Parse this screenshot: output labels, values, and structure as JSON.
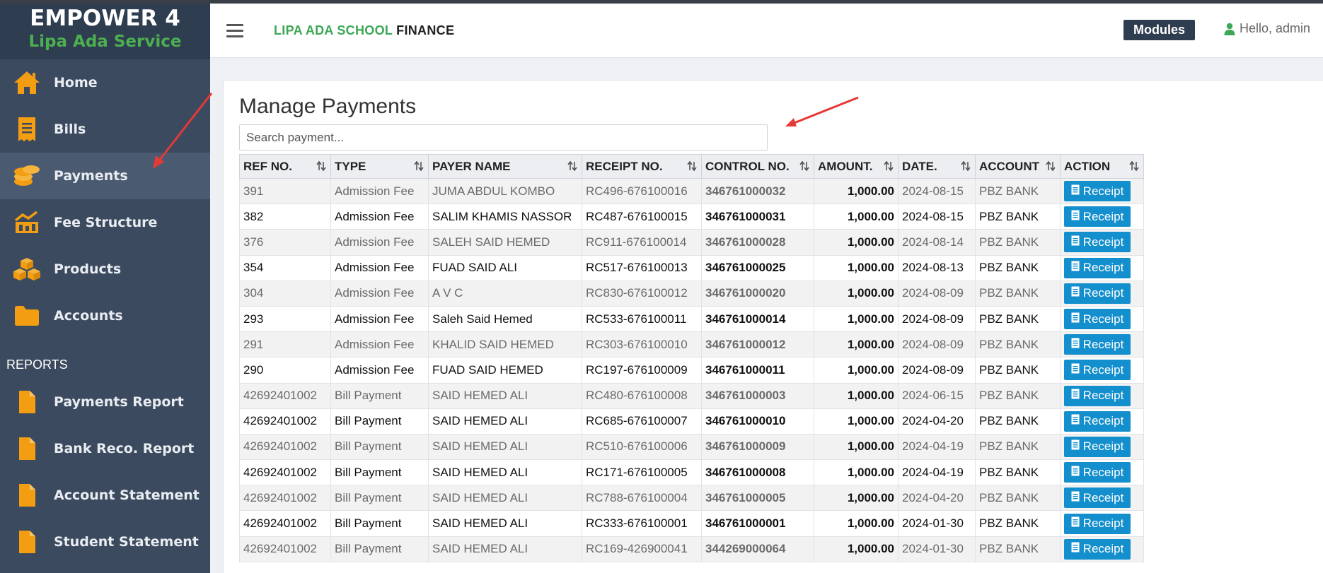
{
  "brand": {
    "title": "EMPOWER 4",
    "subtitle": "Lipa Ada Service"
  },
  "header": {
    "app_title_green": "LIPA ADA SCHOOL",
    "app_title_dark": "FINANCE",
    "modules_label": "Modules",
    "greeting": "Hello, admin"
  },
  "sidebar": {
    "items": [
      {
        "label": "Home",
        "icon": "home-icon"
      },
      {
        "label": "Bills",
        "icon": "receipt-icon"
      },
      {
        "label": "Payments",
        "icon": "coins-icon",
        "active": true
      },
      {
        "label": "Fee Structure",
        "icon": "chart-icon"
      },
      {
        "label": "Products",
        "icon": "cubes-icon"
      },
      {
        "label": "Accounts",
        "icon": "folder-icon"
      }
    ],
    "reports_heading": "REPORTS",
    "reports": [
      {
        "label": "Payments Report",
        "icon": "file-icon"
      },
      {
        "label": "Bank Reco. Report",
        "icon": "file-icon"
      },
      {
        "label": "Account Statement",
        "icon": "file-icon"
      },
      {
        "label": "Student Statement",
        "icon": "file-icon"
      }
    ]
  },
  "main": {
    "title": "Manage Payments",
    "search_placeholder": "Search payment...",
    "columns": [
      "REF NO.",
      "TYPE",
      "PAYER NAME",
      "RECEIPT NO.",
      "CONTROL NO.",
      "AMOUNT.",
      "DATE.",
      "ACCOUNT",
      "ACTION"
    ],
    "receipt_label": "Receipt",
    "rows": [
      [
        "391",
        "Admission Fee",
        "JUMA ABDUL KOMBO",
        "RC496-676100016",
        "346761000032",
        "1,000.00",
        "2024-08-15",
        "PBZ BANK"
      ],
      [
        "382",
        "Admission Fee",
        "SALIM KHAMIS NASSOR",
        "RC487-676100015",
        "346761000031",
        "1,000.00",
        "2024-08-15",
        "PBZ BANK"
      ],
      [
        "376",
        "Admission Fee",
        "SALEH SAID HEMED",
        "RC911-676100014",
        "346761000028",
        "1,000.00",
        "2024-08-14",
        "PBZ BANK"
      ],
      [
        "354",
        "Admission Fee",
        "FUAD SAID ALI",
        "RC517-676100013",
        "346761000025",
        "1,000.00",
        "2024-08-13",
        "PBZ BANK"
      ],
      [
        "304",
        "Admission Fee",
        "A V C",
        "RC830-676100012",
        "346761000020",
        "1,000.00",
        "2024-08-09",
        "PBZ BANK"
      ],
      [
        "293",
        "Admission Fee",
        "Saleh Said Hemed",
        "RC533-676100011",
        "346761000014",
        "1,000.00",
        "2024-08-09",
        "PBZ BANK"
      ],
      [
        "291",
        "Admission Fee",
        "KHALID SAID HEMED",
        "RC303-676100010",
        "346761000012",
        "1,000.00",
        "2024-08-09",
        "PBZ BANK"
      ],
      [
        "290",
        "Admission Fee",
        "FUAD SAID HEMED",
        "RC197-676100009",
        "346761000011",
        "1,000.00",
        "2024-08-09",
        "PBZ BANK"
      ],
      [
        "42692401002",
        "Bill Payment",
        "SAID HEMED ALI",
        "RC480-676100008",
        "346761000003",
        "1,000.00",
        "2024-06-15",
        "PBZ BANK"
      ],
      [
        "42692401002",
        "Bill Payment",
        "SAID HEMED ALI",
        "RC685-676100007",
        "346761000010",
        "1,000.00",
        "2024-04-20",
        "PBZ BANK"
      ],
      [
        "42692401002",
        "Bill Payment",
        "SAID HEMED ALI",
        "RC510-676100006",
        "346761000009",
        "1,000.00",
        "2024-04-19",
        "PBZ BANK"
      ],
      [
        "42692401002",
        "Bill Payment",
        "SAID HEMED ALI",
        "RC171-676100005",
        "346761000008",
        "1,000.00",
        "2024-04-19",
        "PBZ BANK"
      ],
      [
        "42692401002",
        "Bill Payment",
        "SAID HEMED ALI",
        "RC788-676100004",
        "346761000005",
        "1,000.00",
        "2024-04-20",
        "PBZ BANK"
      ],
      [
        "42692401002",
        "Bill Payment",
        "SAID HEMED ALI",
        "RC333-676100001",
        "346761000001",
        "1,000.00",
        "2024-01-30",
        "PBZ BANK"
      ],
      [
        "42692401002",
        "Bill Payment",
        "SAID HEMED ALI",
        "RC169-426900041",
        "344269000064",
        "1,000.00",
        "2024-01-30",
        "PBZ BANK"
      ]
    ]
  },
  "colors": {
    "sidebar": "#3b4a5f",
    "brand_bg": "#2f3d50",
    "accent_green": "#3da756",
    "icon_orange": "#f29d12",
    "receipt_blue": "#138fcd",
    "annotation_red": "#e53935"
  }
}
